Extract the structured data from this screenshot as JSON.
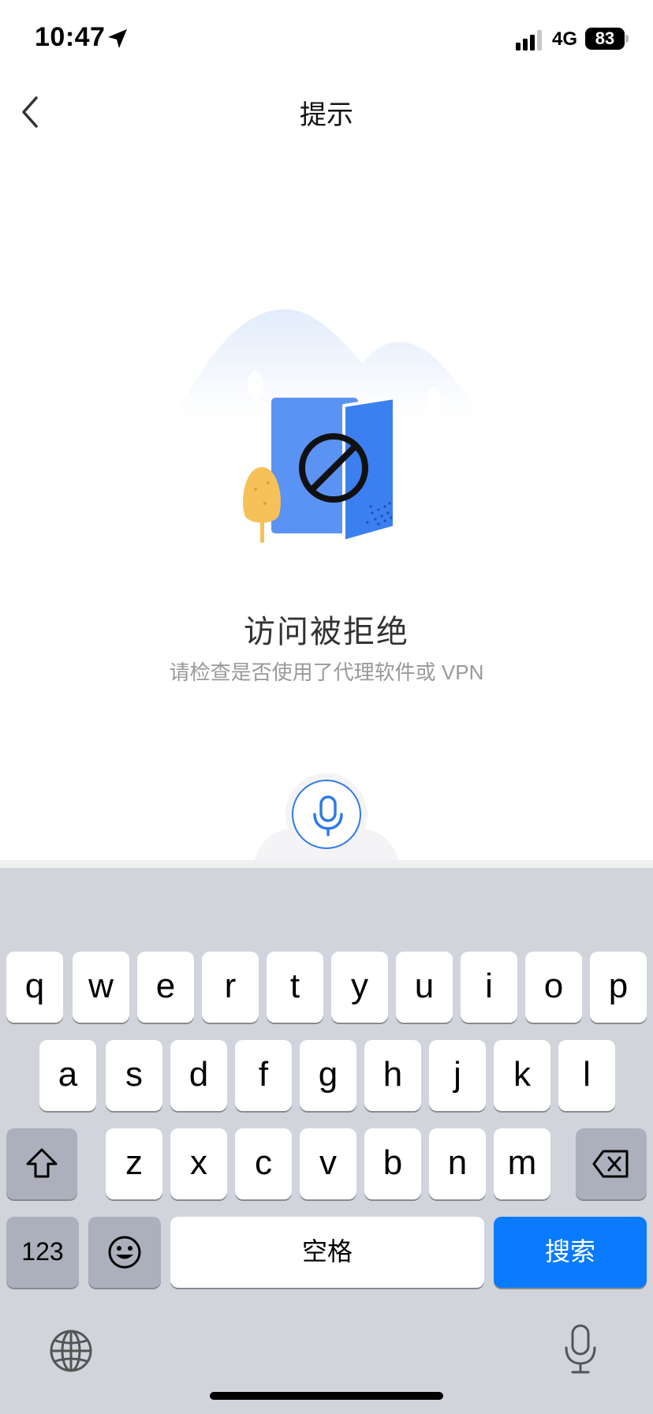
{
  "status_bar": {
    "time": "10:47",
    "network": "4G",
    "battery": "83"
  },
  "nav": {
    "title": "提示"
  },
  "error": {
    "title": "访问被拒绝",
    "subtitle": "请检查是否使用了代理软件或 VPN"
  },
  "keyboard": {
    "row1": [
      "q",
      "w",
      "e",
      "r",
      "t",
      "y",
      "u",
      "i",
      "o",
      "p"
    ],
    "row2": [
      "a",
      "s",
      "d",
      "f",
      "g",
      "h",
      "j",
      "k",
      "l"
    ],
    "row3": [
      "z",
      "x",
      "c",
      "v",
      "b",
      "n",
      "m"
    ],
    "numbers_label": "123",
    "space_label": "空格",
    "search_label": "搜索"
  },
  "colors": {
    "accent": "#0a7aff",
    "voice_ring": "#2f7ae5",
    "keyboard_bg": "#d1d4db"
  }
}
